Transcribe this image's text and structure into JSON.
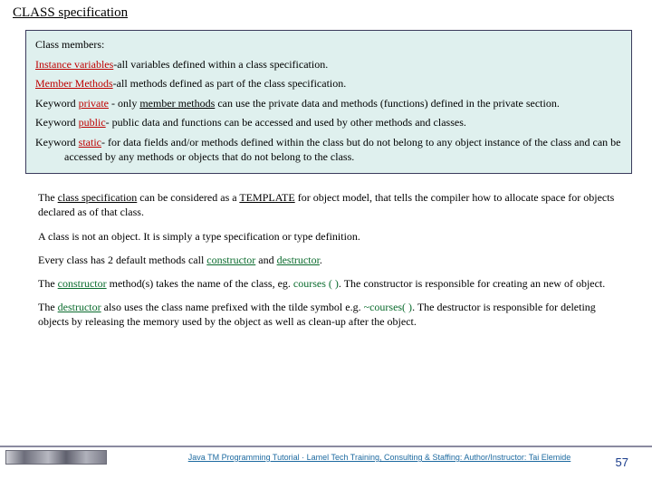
{
  "title": "CLASS specification",
  "box1": {
    "p1": "Class members:",
    "p2_a": "Instance variables",
    "p2_b": "-all variables defined within a class specification.",
    "p3_a": "Member Methods",
    "p3_b": "-all methods defined as part of the class specification.",
    "p4_a": "Keyword ",
    "p4_b": "private",
    "p4_c": " -  only ",
    "p4_d": "member methods",
    "p4_e": " can use the private data and methods (functions) defined in the private section.",
    "p5_a": "Keyword ",
    "p5_b": "public",
    "p5_c": "- public data and functions can be accessed and used by other methods and classes.",
    "p6_a": "Keyword ",
    "p6_b": "static",
    "p6_c": "- for data fields and/or methods defined within the class but do not belong to any object instance of the class and can be",
    "p6_d": "accessed by any methods or objects that do not belong to the class."
  },
  "box2": {
    "p1_a": "The ",
    "p1_b": "class specification",
    "p1_c": " can be considered as a ",
    "p1_d": "TEMPLATE",
    "p1_e": " for object model, that tells the compiler how to allocate space for objects declared as of that class.",
    "p2": "A class is not an object. It is simply a type specification or type definition.",
    "p3_a": "Every class has 2 default methods call ",
    "p3_b": "constructor",
    "p3_c": " and ",
    "p3_d": "destructor",
    "p3_e": ".",
    "p4_a": "The ",
    "p4_b": "constructor",
    "p4_c": " method(s) takes the name of the class, eg. ",
    "p4_d": "courses ( )",
    "p4_e": ". The constructor is responsible for creating an new of object.",
    "p5_a": "The ",
    "p5_b": "destructor",
    "p5_c": " also uses the class name prefixed with the tilde symbol e.g. ",
    "p5_d": "~courses( )",
    "p5_e": ". The destructor is responsible for deleting objects by releasing the memory used by the object as well as clean-up after the object."
  },
  "footer": "Java TM Programming Tutorial  ·  Lamel Tech Training, Consulting & Staffing: Author/Instructor: Tai Elemide",
  "pagenum": "57"
}
